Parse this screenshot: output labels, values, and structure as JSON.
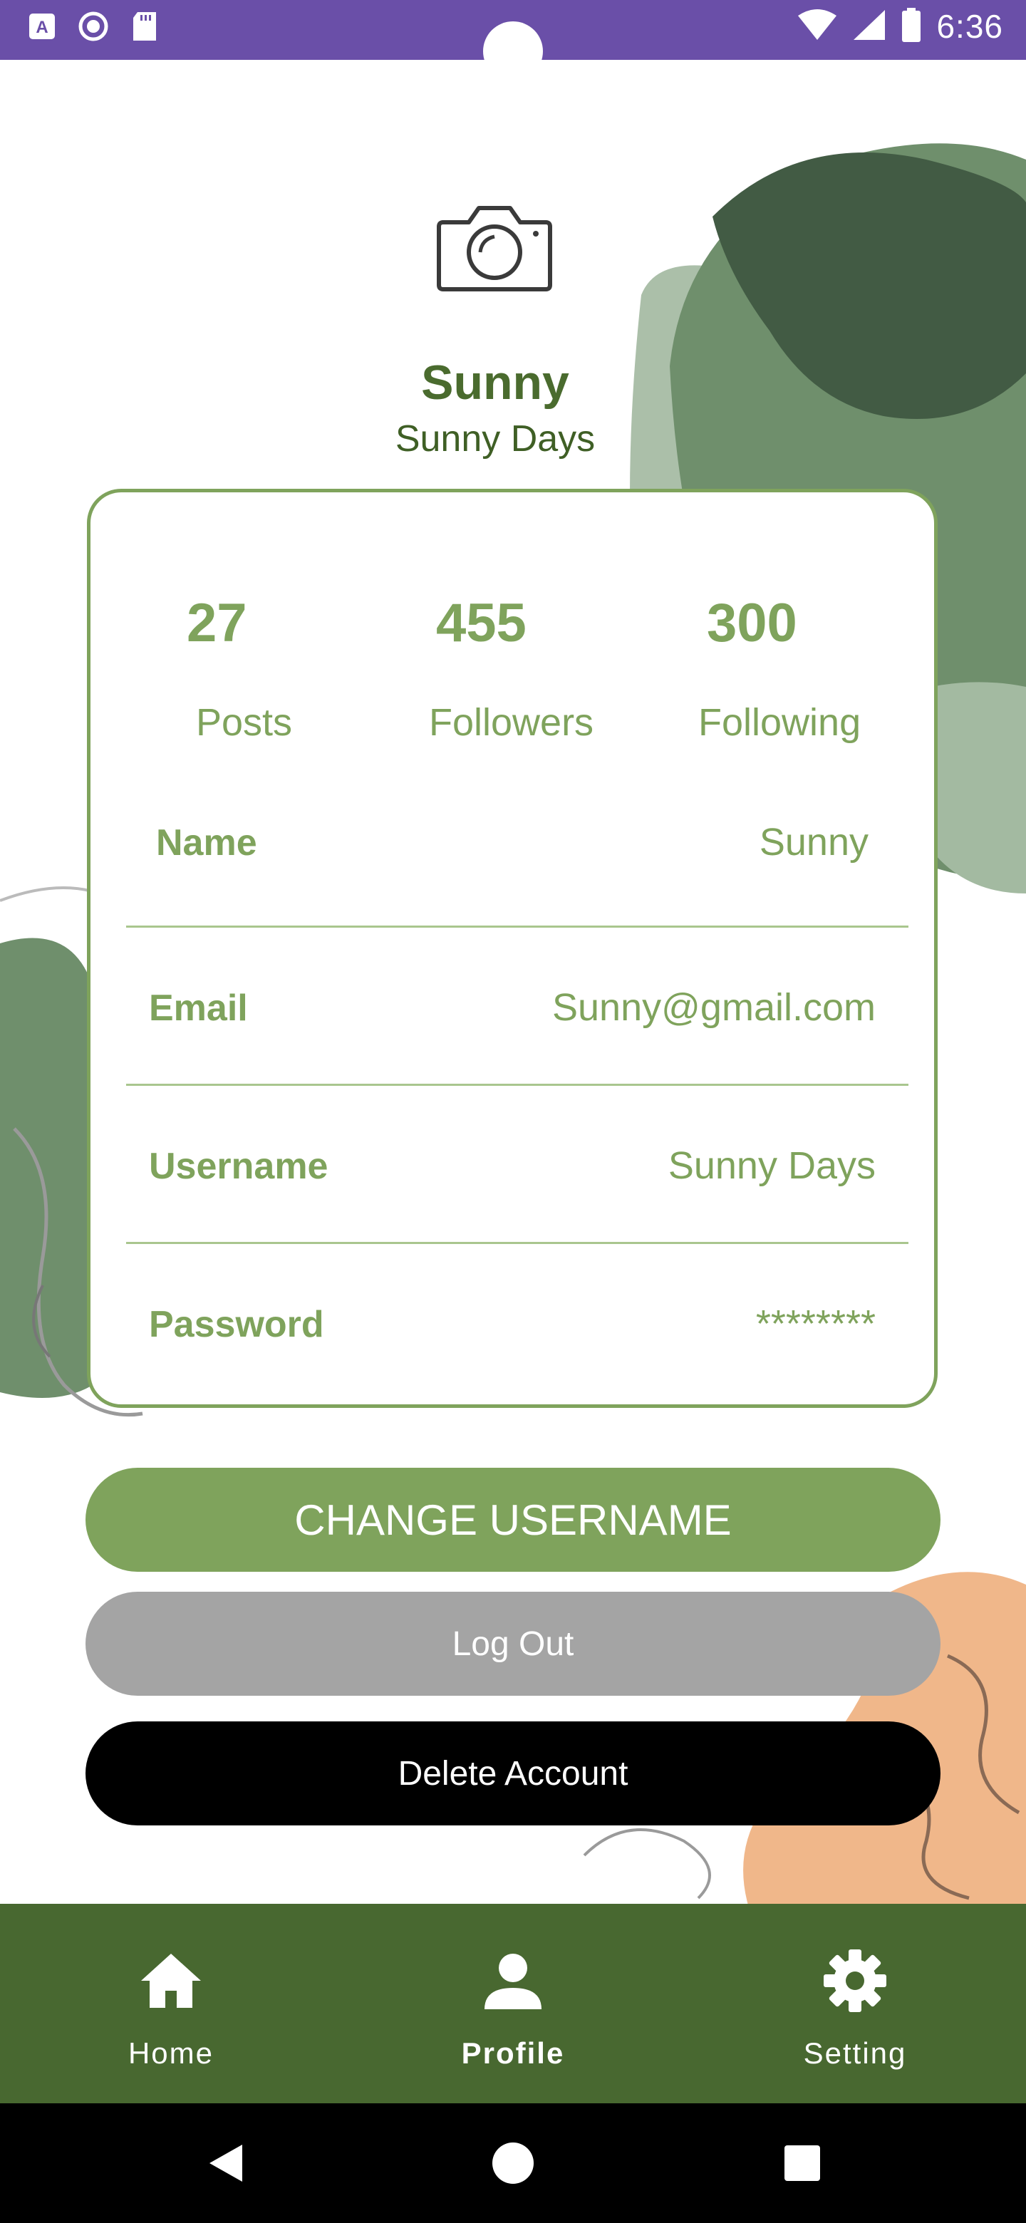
{
  "status_bar": {
    "time": "6:36",
    "icons": [
      "a-icon",
      "record-icon",
      "sd-card-icon",
      "wifi-icon",
      "signal-icon",
      "battery-icon"
    ]
  },
  "profile": {
    "avatar_icon": "camera-icon",
    "name": "Sunny",
    "username": "Sunny Days"
  },
  "stats": [
    {
      "value": "27",
      "label": "Posts"
    },
    {
      "value": "455",
      "label": "Followers"
    },
    {
      "value": "300",
      "label": "Following"
    }
  ],
  "details": {
    "name": {
      "label": "Name",
      "value": "Sunny"
    },
    "email": {
      "label": "Email",
      "value": "Sunny@gmail.com"
    },
    "username": {
      "label": "Username",
      "value": "Sunny Days"
    },
    "password": {
      "label": "Password",
      "value": "********"
    }
  },
  "buttons": {
    "change_username": "CHANGE USERNAME",
    "log_out": "Log Out",
    "delete_account": "Delete Account"
  },
  "bottom_nav": [
    {
      "label": "Home",
      "icon": "home-icon",
      "active": false
    },
    {
      "label": "Profile",
      "icon": "person-icon",
      "active": true
    },
    {
      "label": "Setting",
      "icon": "gear-icon",
      "active": false
    }
  ],
  "system_nav": [
    "back-icon",
    "home-circle-icon",
    "recents-icon"
  ],
  "colors": {
    "status_bar": "#6a4fa8",
    "accent_green": "#7fa35c",
    "dark_green": "#486830",
    "logout_gray": "#a4a4a4",
    "delete_black": "#000000",
    "blob_green": "#6f8f6c",
    "blob_orange": "#f0b78a"
  }
}
